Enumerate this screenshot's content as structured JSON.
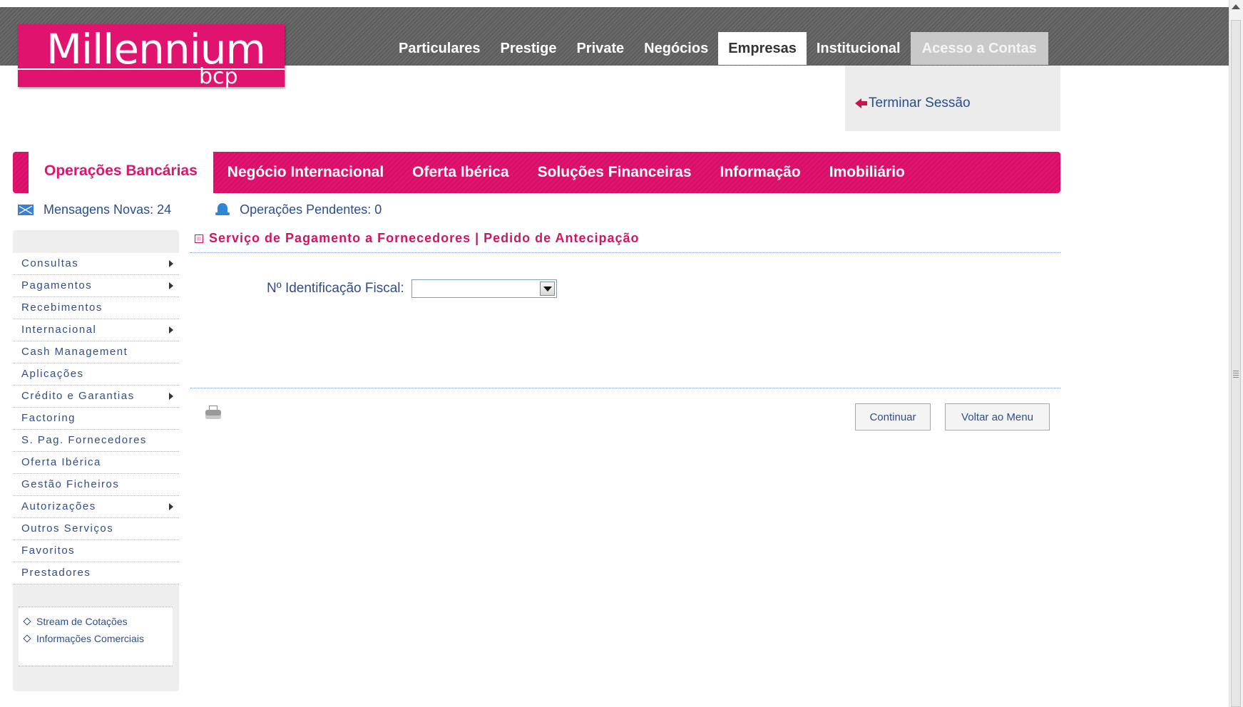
{
  "brand": {
    "name": "Millennium",
    "sub": "bcp",
    "color": "#e0136f"
  },
  "top_nav": {
    "items": [
      {
        "label": "Particulares"
      },
      {
        "label": "Prestige"
      },
      {
        "label": "Private"
      },
      {
        "label": "Negócios"
      },
      {
        "label": "Empresas",
        "active": true
      },
      {
        "label": "Institucional"
      }
    ],
    "access_label": "Acesso a Contas",
    "logout_label": "Terminar Sessão"
  },
  "main_nav": {
    "items": [
      {
        "label": "Operações Bancárias",
        "active": true
      },
      {
        "label": "Negócio Internacional"
      },
      {
        "label": "Oferta Ibérica"
      },
      {
        "label": "Soluções Financeiras"
      },
      {
        "label": "Informação"
      },
      {
        "label": "Imobiliário"
      }
    ]
  },
  "status": {
    "messages": "Mensagens Novas: 24",
    "pending": "Operações Pendentes: 0"
  },
  "sidebar": {
    "items": [
      {
        "label": "Consultas",
        "submenu": true
      },
      {
        "label": "Pagamentos",
        "submenu": true
      },
      {
        "label": "Recebimentos",
        "submenu": false
      },
      {
        "label": "Internacional",
        "submenu": true
      },
      {
        "label": "Cash Management",
        "submenu": false
      },
      {
        "label": "Aplicações",
        "submenu": false
      },
      {
        "label": "Crédito e Garantias",
        "submenu": true
      },
      {
        "label": "Factoring",
        "submenu": false
      },
      {
        "label": "S. Pag. Fornecedores",
        "submenu": false
      },
      {
        "label": "Oferta Ibérica",
        "submenu": false
      },
      {
        "label": "Gestão Ficheiros",
        "submenu": false
      },
      {
        "label": "Autorizações",
        "submenu": true
      },
      {
        "label": "Outros Serviços",
        "submenu": false
      },
      {
        "label": "Favoritos",
        "submenu": false
      },
      {
        "label": "Prestadores",
        "submenu": false
      }
    ],
    "links": [
      {
        "label": "Stream de Cotações"
      },
      {
        "label": "Informações Comerciais"
      }
    ]
  },
  "content": {
    "title": "Serviço de Pagamento a Fornecedores | Pedido de Antecipação",
    "nif_label": "Nº Identificação Fiscal:",
    "nif_value": "",
    "continue_label": "Continuar",
    "back_label": "Voltar ao Menu"
  }
}
